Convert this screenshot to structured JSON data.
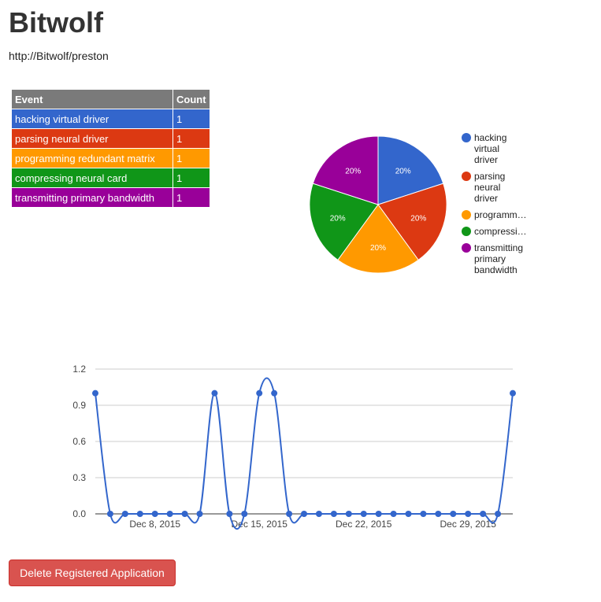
{
  "header": {
    "title": "Bitwolf",
    "url": "http://Bitwolf/preston"
  },
  "table": {
    "columns": [
      "Event",
      "Count"
    ],
    "rows": [
      {
        "event": "hacking virtual driver",
        "count": "1",
        "color": "#3366cc"
      },
      {
        "event": "parsing neural driver",
        "count": "1",
        "color": "#dc3912"
      },
      {
        "event": "programming redundant matrix",
        "count": "1",
        "color": "#ff9900"
      },
      {
        "event": "compressing neural card",
        "count": "1",
        "color": "#109618"
      },
      {
        "event": "transmitting primary bandwidth",
        "count": "1",
        "color": "#990099"
      }
    ]
  },
  "actions": {
    "delete_label": "Delete Registered Application"
  },
  "chart_data": [
    {
      "type": "pie",
      "slices": [
        {
          "label": "hacking virtual driver",
          "legend_lines": [
            "hacking",
            "virtual",
            "driver"
          ],
          "value": 1,
          "percent_label": "20%",
          "color": "#3366cc"
        },
        {
          "label": "parsing neural driver",
          "legend_lines": [
            "parsing",
            "neural",
            "driver"
          ],
          "value": 1,
          "percent_label": "20%",
          "color": "#dc3912"
        },
        {
          "label": "programming redundant matrix",
          "legend_lines": [
            "programm…"
          ],
          "value": 1,
          "percent_label": "20%",
          "color": "#ff9900"
        },
        {
          "label": "compressing neural card",
          "legend_lines": [
            "compressi…"
          ],
          "value": 1,
          "percent_label": "20%",
          "color": "#109618"
        },
        {
          "label": "transmitting primary bandwidth",
          "legend_lines": [
            "transmitting",
            "primary",
            "bandwidth"
          ],
          "value": 1,
          "percent_label": "20%",
          "color": "#990099"
        }
      ],
      "legend_position": "right"
    },
    {
      "type": "line",
      "series": [
        {
          "color": "#3366cc",
          "x": [
            "2015-12-04",
            "2015-12-05",
            "2015-12-06",
            "2015-12-07",
            "2015-12-08",
            "2015-12-09",
            "2015-12-10",
            "2015-12-11",
            "2015-12-12",
            "2015-12-13",
            "2015-12-14",
            "2015-12-15",
            "2015-12-16",
            "2015-12-17",
            "2015-12-18",
            "2015-12-19",
            "2015-12-20",
            "2015-12-21",
            "2015-12-22",
            "2015-12-23",
            "2015-12-24",
            "2015-12-25",
            "2015-12-26",
            "2015-12-27",
            "2015-12-28",
            "2015-12-29",
            "2015-12-30",
            "2015-12-31",
            "2016-01-01"
          ],
          "values": [
            1,
            0,
            0,
            0,
            0,
            0,
            0,
            0,
            1,
            0,
            0,
            1,
            1,
            0,
            0,
            0,
            0,
            0,
            0,
            0,
            0,
            0,
            0,
            0,
            0,
            0,
            0,
            0,
            1
          ]
        }
      ],
      "x_tick_labels": [
        {
          "label": "Dec 8, 2015",
          "date": "2015-12-08"
        },
        {
          "label": "Dec 15, 2015",
          "date": "2015-12-15"
        },
        {
          "label": "Dec 22, 2015",
          "date": "2015-12-22"
        },
        {
          "label": "Dec 29, 2015",
          "date": "2015-12-29"
        }
      ],
      "y_ticks": [
        "0.0",
        "0.3",
        "0.6",
        "0.9",
        "1.2"
      ],
      "y_tick_values": [
        0,
        0.3,
        0.6,
        0.9,
        1.2
      ],
      "ylim": [
        0,
        1.2
      ],
      "grid": true,
      "curve": "smooth"
    }
  ]
}
